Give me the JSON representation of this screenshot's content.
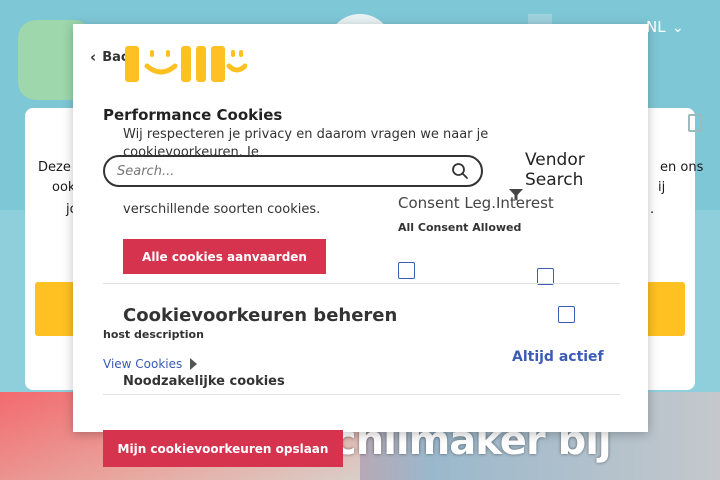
{
  "background": {
    "language": "NL",
    "line_left_1": "Deze w",
    "line_left_2": "ook",
    "line_left_3": "jo",
    "line_right_1": "en ons",
    "line_right_2": "ij",
    "line_right_3": ".",
    "headline": "chilmaker bij"
  },
  "modal": {
    "back_label": "Back",
    "performance_title": "Performance Cookies",
    "intro_line_1": "Wij respecteren je privacy en daarom vragen we naar je cookievoorkeuren. Je",
    "intro_line_2": "verschillende soorten cookies.",
    "search_placeholder": "Search...",
    "vendor_search_label": "Vendor Search",
    "consent_header": "Consent Leg.Interest",
    "all_consent_label": "All Consent Allowed",
    "accept_all_label": "Alle cookies aanvaarden",
    "prefs_title": "Cookievoorkeuren beheren",
    "host_description": "host description",
    "view_cookies_label": "View Cookies",
    "always_active_label": "Altijd actief",
    "necessary_title": "Noodzakelijke cookies",
    "save_label": "Mijn cookievoorkeuren opslaan"
  },
  "colors": {
    "accent_red": "#d6334f",
    "link_blue": "#3b5bb5",
    "brand_yellow": "#ffc121"
  }
}
